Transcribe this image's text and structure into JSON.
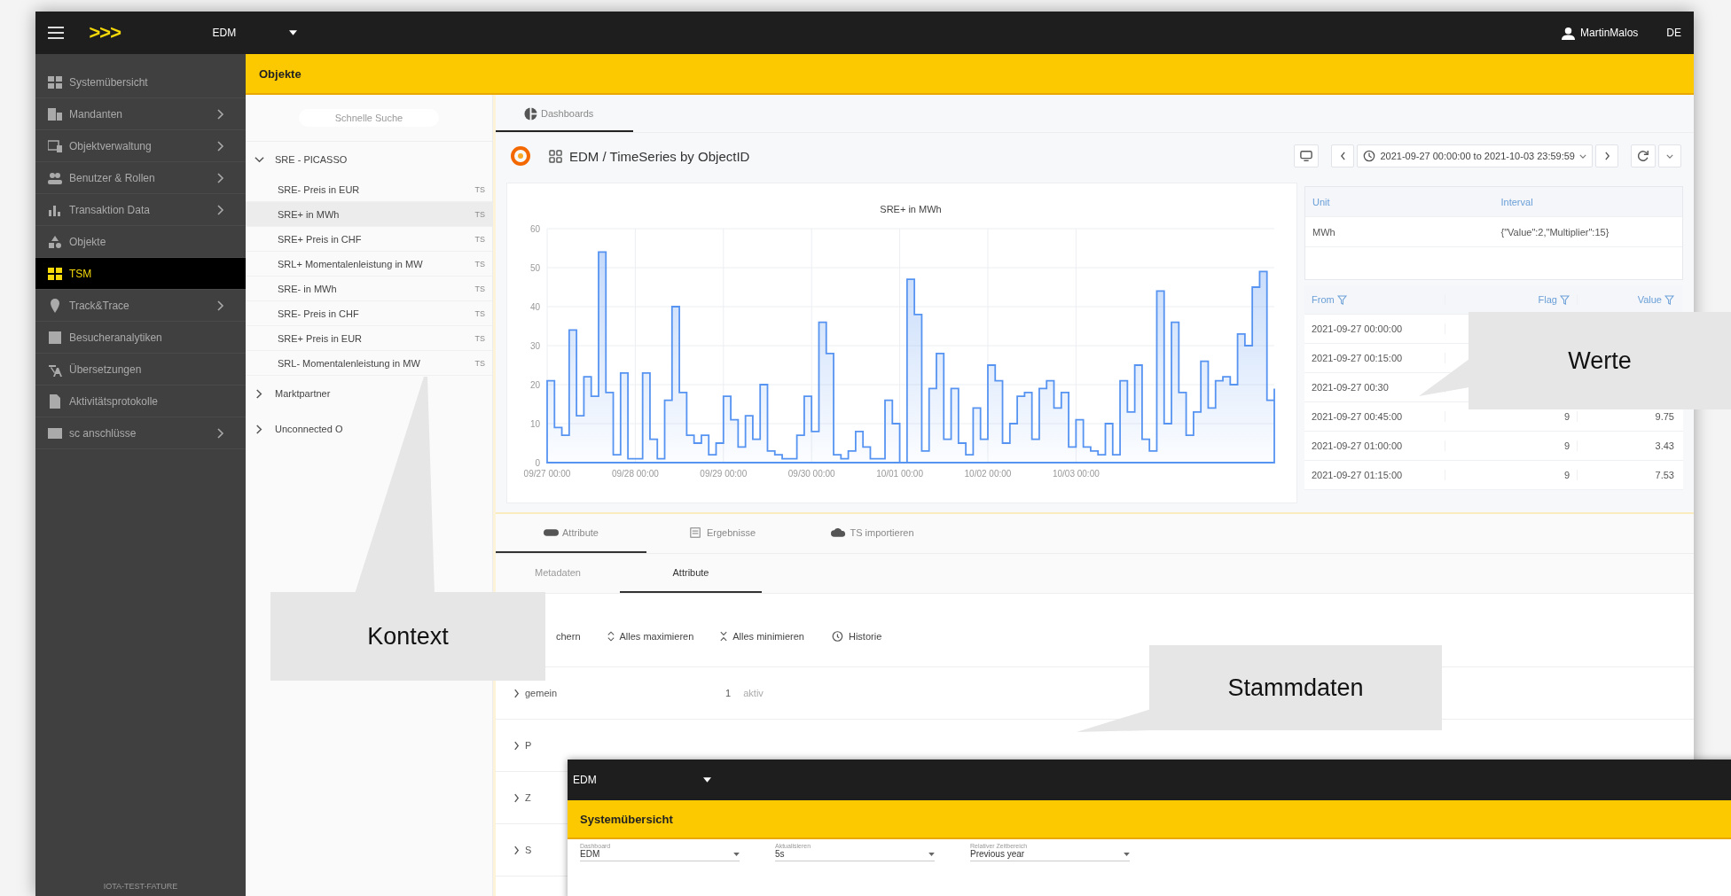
{
  "topbar": {
    "logo": ">>>",
    "app": "EDM",
    "user": "MartinMalos",
    "lang": "DE"
  },
  "sidebar": {
    "items": [
      {
        "label": "Systemübersicht",
        "submenu": false,
        "selected": false
      },
      {
        "label": "Mandanten",
        "submenu": true,
        "selected": false
      },
      {
        "label": "Objektverwaltung",
        "submenu": true,
        "selected": false
      },
      {
        "label": "Benutzer & Rollen",
        "submenu": true,
        "selected": false
      },
      {
        "label": "Transaktion Data",
        "submenu": true,
        "selected": false
      },
      {
        "label": "Objekte",
        "submenu": false,
        "selected": false
      },
      {
        "label": "TSM",
        "submenu": false,
        "selected": true
      },
      {
        "label": "Track&Trace",
        "submenu": true,
        "selected": false
      },
      {
        "label": "Besucheranalytiken",
        "submenu": false,
        "selected": false
      },
      {
        "label": "Übersetzungen",
        "submenu": false,
        "selected": false
      },
      {
        "label": "Aktivitätsprotokolle",
        "submenu": false,
        "selected": false
      },
      {
        "label": "sc anschlüsse",
        "submenu": true,
        "selected": false
      }
    ],
    "footer": "IOTA-TEST-FATURE"
  },
  "header": {
    "title": "Objekte"
  },
  "tree": {
    "placeholder": "Schnelle Suche",
    "nodes": [
      {
        "label": "SRE - PICASSO",
        "expanded": true,
        "children": [
          {
            "label": "SRE- Preis in EUR",
            "tag": "TS",
            "selected": false
          },
          {
            "label": "SRE+ in MWh",
            "tag": "TS",
            "selected": true
          },
          {
            "label": "SRE+ Preis in CHF",
            "tag": "TS",
            "selected": false
          },
          {
            "label": "SRL+ Momentalenleistung in MW",
            "tag": "TS",
            "selected": false
          },
          {
            "label": "SRE- in MWh",
            "tag": "TS",
            "selected": false
          },
          {
            "label": "SRE- Preis in CHF",
            "tag": "TS",
            "selected": false
          },
          {
            "label": "SRE+ Preis in EUR",
            "tag": "TS",
            "selected": false
          },
          {
            "label": "SRL- Momentalenleistung in MW",
            "tag": "TS",
            "selected": false
          }
        ]
      },
      {
        "label": "Marktpartner",
        "expanded": false
      },
      {
        "label": "Unconnected O",
        "expanded": false
      }
    ]
  },
  "dashboard_tab": {
    "label": "Dashboards",
    "selected": true
  },
  "grafana": {
    "title": "EDM / TimeSeries by ObjectID",
    "time_range": "2021-09-27 00:00:00 to 2021-10-03 23:59:59"
  },
  "chart_data": {
    "type": "area",
    "title": "SRE+ in MWh",
    "categories": [
      "09/27 00:00",
      null,
      null,
      null,
      null,
      null,
      null,
      null,
      null,
      null,
      null,
      null,
      "09/28 00:00",
      null,
      null,
      null,
      null,
      null,
      null,
      null,
      null,
      null,
      null,
      null,
      "09/29 00:00",
      null,
      null,
      null,
      null,
      null,
      null,
      null,
      null,
      null,
      null,
      null,
      "09/30 00:00",
      null,
      null,
      null,
      null,
      null,
      null,
      null,
      null,
      null,
      null,
      null,
      "10/01 00:00",
      null,
      null,
      null,
      null,
      null,
      null,
      null,
      null,
      null,
      null,
      null,
      "10/02 00:00",
      null,
      null,
      null,
      null,
      null,
      null,
      null,
      null,
      null,
      null,
      null,
      "10/03 00:00",
      null,
      null,
      null,
      null,
      null,
      null,
      null,
      null,
      null,
      null,
      null,
      null,
      null,
      null,
      null,
      null,
      null,
      null,
      null,
      null,
      null,
      null,
      null,
      null,
      null,
      null,
      null
    ],
    "series": [
      {
        "color": "#5794f2",
        "values": [
          21,
          9,
          7,
          34,
          12,
          22,
          17,
          54,
          18,
          2,
          23,
          1,
          1,
          23,
          6,
          1,
          16,
          40,
          18,
          7,
          5,
          7,
          2,
          5,
          17,
          11,
          4,
          12,
          6,
          20,
          3,
          2,
          1,
          1,
          7,
          17,
          8,
          36,
          28,
          2,
          1,
          3,
          8,
          4,
          1,
          1,
          16,
          10,
          0,
          47,
          38,
          3,
          19,
          28,
          6,
          19,
          5,
          2,
          14,
          6,
          25,
          21,
          5,
          10,
          17,
          18,
          6,
          19,
          21,
          14,
          18,
          4,
          11,
          4,
          3,
          2,
          10,
          2,
          21,
          13,
          25,
          6,
          3,
          44,
          10,
          36,
          18,
          7,
          13,
          26,
          14,
          21,
          22,
          20,
          33,
          30,
          45,
          49,
          16,
          19
        ]
      }
    ],
    "ylim": [
      0,
      60
    ],
    "grid": true,
    "yticks": [
      0,
      10,
      20,
      30,
      40,
      50,
      60
    ]
  },
  "info_table": {
    "columns": [
      "Unit",
      "Interval"
    ],
    "row": [
      "MWh",
      "{\"Value\":2,\"Multiplier\":15}"
    ]
  },
  "values_table": {
    "columns": [
      "From",
      "Flag",
      "Value"
    ],
    "rows": [
      {
        "from": "2021-09-27 00:00:00"
      },
      {
        "from": "2021-09-27 00:15:00"
      },
      {
        "from": "2021-09-27 00:30"
      },
      {
        "from": "2021-09-27 00:45:00",
        "flag": "9",
        "value": "9.75"
      },
      {
        "from": "2021-09-27 01:00:00",
        "flag": "9",
        "value": "3.43"
      },
      {
        "from": "2021-09-27 01:15:00",
        "flag": "9",
        "value": "7.53"
      }
    ]
  },
  "detail_tabs": [
    {
      "label": "Attribute",
      "selected": true
    },
    {
      "label": "Ergebnisse",
      "selected": false
    },
    {
      "label": "TS importieren",
      "selected": false
    }
  ],
  "sub_tabs": [
    {
      "label": "Metadaten",
      "selected": false
    },
    {
      "label": "Attribute",
      "selected": true
    }
  ],
  "toolbar": [
    "chern",
    "Alles maximieren",
    "Alles minimieren",
    "Historie"
  ],
  "groups": [
    {
      "label": "gemein",
      "number": "1",
      "status": "aktiv"
    },
    {
      "label": "P"
    },
    {
      "label": "Z"
    },
    {
      "label": "S"
    }
  ],
  "callouts": [
    "Kontext",
    "Werte",
    "Stammdaten"
  ],
  "inset": {
    "app": "EDM",
    "title": "Systemübersicht",
    "fields": [
      {
        "label": "Dashboard",
        "value": "EDM"
      },
      {
        "label": "Aktualisieren",
        "value": "5s"
      },
      {
        "label": "Relativer Zeitbereich",
        "value": "Previous year"
      }
    ]
  }
}
